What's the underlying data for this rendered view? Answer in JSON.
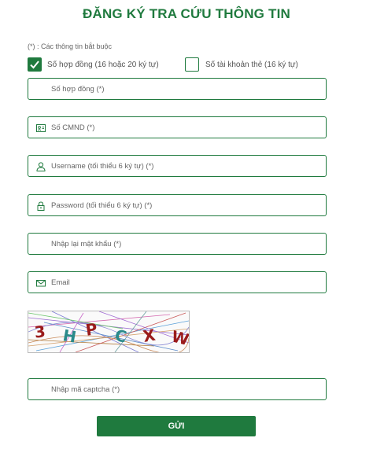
{
  "form": {
    "title": "ĐĂNG KÝ TRA CỨU THÔNG TIN",
    "required_note": "(*) : Các thông tin bắt buộc",
    "options": [
      {
        "label": "Số hợp đồng (16 hoặc 20 ký tự)",
        "checked": true
      },
      {
        "label": "Số tài khoản thẻ (16 ký tự)",
        "checked": false
      }
    ],
    "fields": {
      "contract": {
        "placeholder": "Số hợp đồng (*)",
        "icon": "none"
      },
      "id_number": {
        "placeholder": "Số CMND (*)",
        "icon": "id-card-icon"
      },
      "username": {
        "placeholder": "Username (tối thiểu 6 ký tự) (*)",
        "icon": "user-icon"
      },
      "password": {
        "placeholder": "Password (tối thiểu 6 ký tự) (*)",
        "icon": "lock-icon"
      },
      "confirm": {
        "placeholder": "Nhập lại mật khẩu (*)",
        "icon": "none"
      },
      "email": {
        "placeholder": "Email",
        "icon": "mail-icon"
      },
      "captcha": {
        "placeholder": "Nhập mã captcha (*)",
        "icon": "none"
      }
    },
    "captcha_chars": [
      "3",
      "H",
      "P",
      "C",
      "X",
      "W"
    ],
    "submit_label": "GỬI",
    "colors": {
      "accent": "#1f7a3e"
    }
  }
}
